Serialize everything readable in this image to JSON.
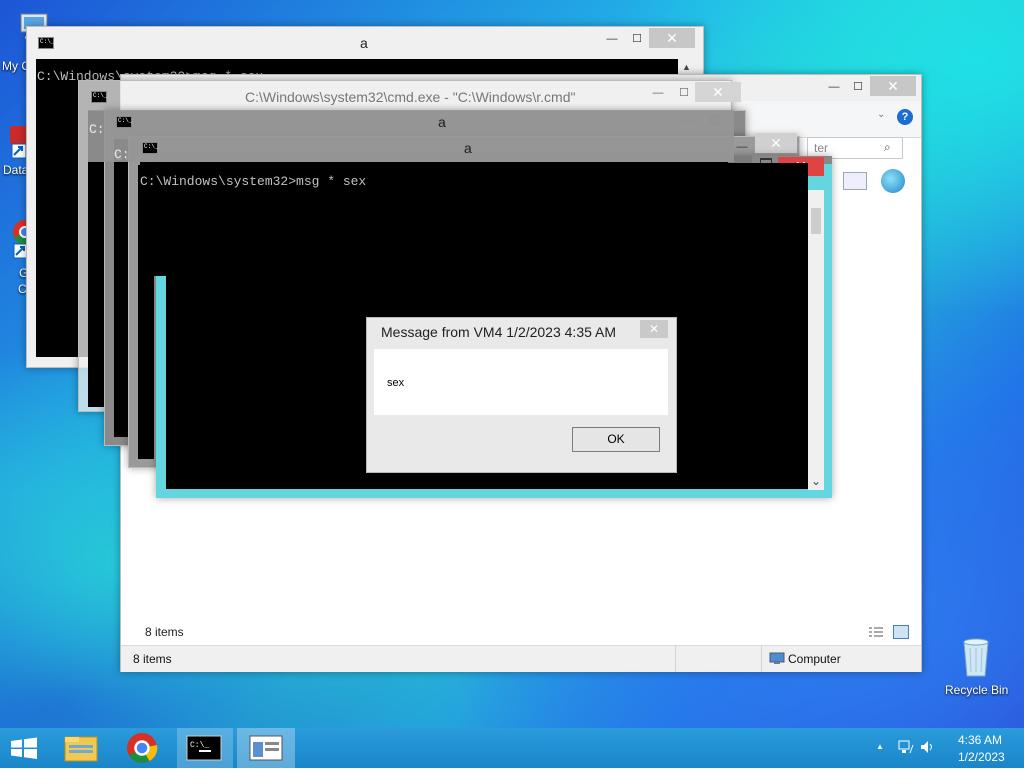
{
  "desktop": {
    "icons": [
      {
        "label": "My C",
        "icon": "computer-icon"
      },
      {
        "label": "Data",
        "icon": "shortcut-icon"
      },
      {
        "label": "G",
        "icon": "chrome-icon"
      },
      {
        "label": "C",
        "icon": "chrome-icon-cont"
      },
      {
        "label": "Recycle Bin",
        "icon": "recycle-bin-icon"
      }
    ]
  },
  "windows": {
    "back_cmd": {
      "title": "a",
      "command": "C:\\Windows\\system32>msg * sex"
    },
    "mid_cmd": {
      "title": "C:\\Windows\\system32\\cmd.exe - \"C:\\Windows\\r.cmd\""
    },
    "stack_a1": {
      "title": "a",
      "prompt": "C:"
    },
    "stack_a2": {
      "title": "a",
      "prompt": "C:"
    },
    "front_cmd": {
      "title": "a",
      "command": "C:\\Windows\\system32>msg * sex"
    },
    "explorer": {
      "search_placeholder": "ter",
      "status_items_inner": "8 items",
      "status_items": "8 items",
      "location": "Computer",
      "help": "?"
    }
  },
  "dialog": {
    "title": "Message from VM4 1/2/2023 4:35 AM",
    "message": "sex",
    "ok_label": "OK",
    "close": "✕"
  },
  "taskbar": {
    "time": "4:36 AM",
    "date": "1/2/2023",
    "tray_up": "▲"
  },
  "glyphs": {
    "minimize": "—",
    "maximize": "☐",
    "close": "✕",
    "scroll_up": "▲",
    "scroll_down": "⌄"
  }
}
